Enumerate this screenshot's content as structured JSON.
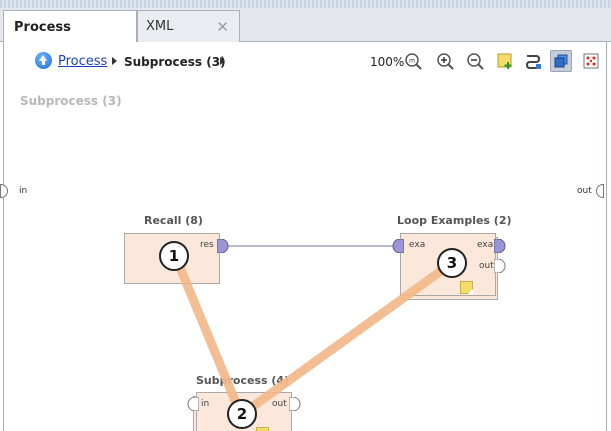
{
  "tabs": [
    {
      "label": "Process"
    },
    {
      "label": "XML",
      "close": "✕"
    }
  ],
  "breadcrumb": {
    "link": "Process",
    "current": "Subprocess (3)"
  },
  "toolbar": {
    "zoom": "100%"
  },
  "canvas": {
    "title": "Subprocess (3)",
    "left_port": "in",
    "right_port": "out"
  },
  "operators": {
    "recall": {
      "title": "Recall (8)",
      "out_port": "res",
      "badge": "1"
    },
    "subprocess": {
      "title": "Subprocess (4)",
      "in_port": "in",
      "out_port": "out",
      "badge": "2"
    },
    "loop": {
      "title": "Loop Examples (2)",
      "in_port": "exa",
      "out_port1": "exa",
      "out_port2": "out",
      "badge": "3"
    }
  },
  "colors": {
    "operator_fill": "#fbe8da",
    "connection_line": "#8a8fb8",
    "annotation_line": "#f2b88a",
    "port_fill": "#9a95d6",
    "link": "#1a3fc8"
  },
  "icons": [
    "up-icon",
    "zoom-fit-icon",
    "zoom-in-icon",
    "zoom-out-icon",
    "add-note-icon",
    "auto-wire-icon",
    "layer-icon",
    "arrange-icon"
  ]
}
